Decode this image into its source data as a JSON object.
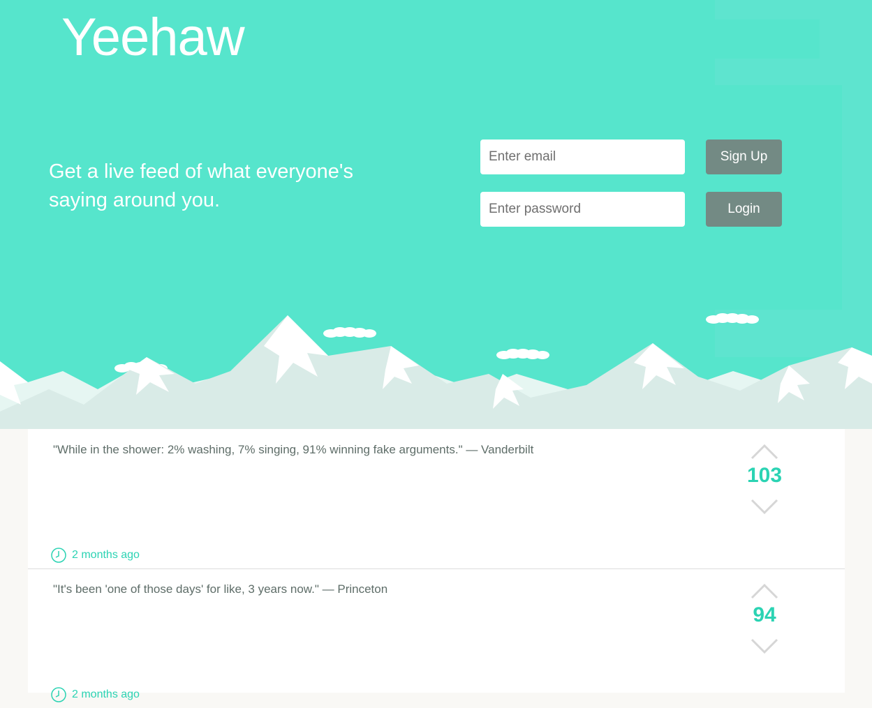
{
  "brand": {
    "logo": "Yeehaw"
  },
  "hero": {
    "tagline": "Get a live feed of what everyone's saying around you.",
    "email_placeholder": "Enter email",
    "password_placeholder": "Enter password",
    "signup_label": "Sign Up",
    "login_label": "Login",
    "colors": {
      "background": "#56e5cc",
      "button": "#738a84"
    }
  },
  "feed": {
    "posts": [
      {
        "text": "\"While in the shower: 2% washing, 7% singing, 91% winning fake arguments.\" — Vanderbilt",
        "votes": "103",
        "time": "2 months ago"
      },
      {
        "text": "\"It's been 'one of those days' for like, 3 years now.\" — Princeton",
        "votes": "94",
        "time": "2 months ago"
      }
    ],
    "colors": {
      "accent": "#2bd3b3",
      "text": "#5e6d68",
      "chevron": "#d6d6d6"
    },
    "icons": {
      "up": "chevron-up-icon",
      "down": "chevron-down-icon",
      "time": "clock-icon"
    }
  }
}
